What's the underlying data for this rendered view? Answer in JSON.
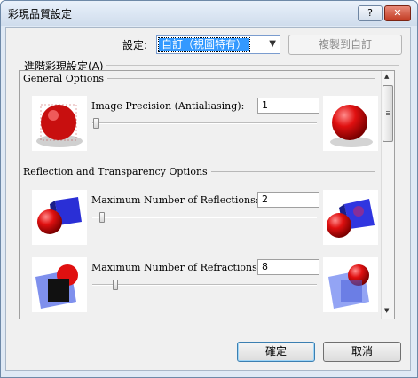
{
  "window": {
    "title": "彩現品質設定",
    "help_button": "?",
    "close_button": "✕"
  },
  "settings_row": {
    "label": "設定:",
    "select_value": "自訂（視圖特有）",
    "copy_button": "複製到自訂"
  },
  "advanced_group": {
    "label": "進階彩現設定(A)"
  },
  "sections": {
    "general": {
      "title": "General Options",
      "options": [
        {
          "label": "Image Precision (Antialiasing):",
          "value": "1",
          "slider_fraction": 0.0
        }
      ]
    },
    "reflection": {
      "title": "Reflection and Transparency Options",
      "options": [
        {
          "label": "Maximum Number of Reflections:",
          "value": "2",
          "slider_fraction": 0.03
        },
        {
          "label": "Maximum Number of Refractions:",
          "value": "8",
          "slider_fraction": 0.09
        }
      ]
    }
  },
  "footer": {
    "ok": "確定",
    "cancel": "取消"
  },
  "colors": {
    "accent": "#3399ff",
    "sphere_red": "#e01010",
    "cube_blue": "#2a2fd6"
  }
}
